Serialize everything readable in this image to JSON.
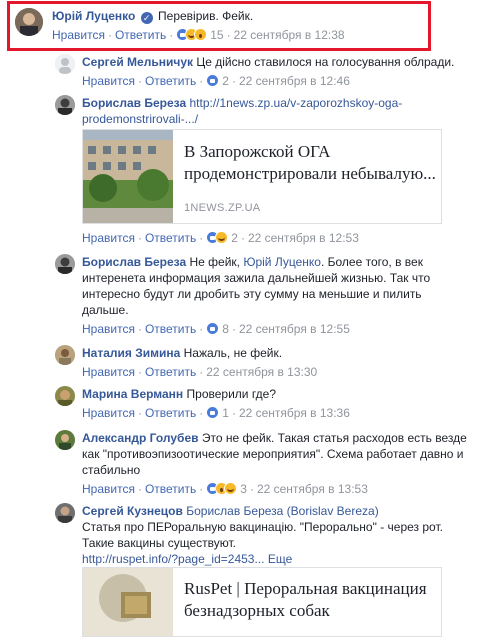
{
  "common": {
    "like_label": "Нравится",
    "reply_label": "Ответить",
    "dot": "·",
    "verified_glyph": "✓"
  },
  "comments": [
    {
      "author": "Юрій Луценко",
      "verified": true,
      "text": "Перевірив. Фейк.",
      "reactions_count": "15",
      "time": "22 сентября в 12:38"
    },
    {
      "author": "Сергей Мельничук",
      "text": "Це дійсно ставилося на голосування облради.",
      "reactions_count": "2",
      "time": "22 сентября в 12:46"
    },
    {
      "author": "Борислав Береза",
      "link_line1": "http://1news.zp.ua/v-zaporozhskoy-oga-",
      "link_line2": "prodemonstrirovali-.../",
      "reactions_count": "2",
      "time": "22 сентября в 12:53",
      "preview": {
        "title_line1": "В Запорожской ОГА",
        "title_line2": "продемонстрировали небывалую...",
        "source": "1NEWS.ZP.UA"
      }
    },
    {
      "author": "Борислав Береза",
      "text_line1": "Не фейк,",
      "tagged": "Юрій Луценко",
      "text_line1b": ". Более того, в век",
      "text_line2": "интеренета информация зажила дальнейшей жизнью. Так что",
      "text_line3": "интересно будут ли дробить эту сумму на меньшие и пилить",
      "text_line4": "дальше.",
      "reactions_count": "8",
      "time": "22 сентября в 12:55"
    },
    {
      "author": "Наталия Зимина",
      "text": "Нажаль, не фейк.",
      "time": "22 сентября в 13:30"
    },
    {
      "author": "Марина Верманн",
      "text": "Проверили где?",
      "reactions_count": "1",
      "time": "22 сентября в 13:36"
    },
    {
      "author": "Александр Голубев",
      "text_line1": "Это не фейк. Такая статья расходов есть везде",
      "text_line2": "как \"противоэпизоотические мероприятия\". Схема работает давно и",
      "text_line3": "стабильно",
      "reactions_count": "3",
      "time": "22 сентября в 13:53"
    },
    {
      "author": "Сергей Кузнецов",
      "tagged": "Борислав Береза (Borislav Bereza)",
      "text_line1": "Статья про ПЕРоральную вакцинацію. \"Перорально\" - через рот.",
      "text_line2": "Такие вакцины существуют.",
      "link": "http://ruspet.info/?page_id=2453...",
      "more": "Еще",
      "preview": {
        "title_line1": "RusPet | Пероральная вакцинация",
        "title_line2": "безнадзорных собак"
      }
    }
  ],
  "colors": {
    "highlight": "#e4162b",
    "link_blue": "#365899",
    "meta_gray": "#90949c",
    "action_blue": "#4267b2"
  }
}
